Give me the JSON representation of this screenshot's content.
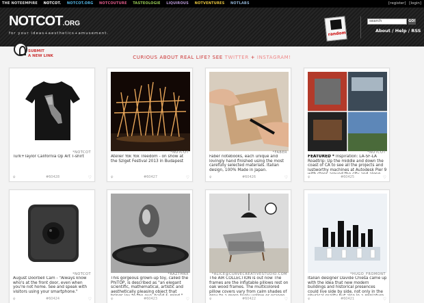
{
  "topnav": {
    "items": [
      {
        "label": "THE NOTEEMPIRE",
        "color": "#dddddd"
      },
      {
        "label": "NOTCOT.",
        "color": "#ffffff"
      },
      {
        "label": "NOTCOT.ORG",
        "color": "#55b7e6"
      },
      {
        "label": "NOTCOUTURE",
        "color": "#e05b8a"
      },
      {
        "label": "TASTEOLOGIE",
        "color": "#9acd57"
      },
      {
        "label": "LIQUIROUS",
        "color": "#b99ad6"
      },
      {
        "label": "NOTVENTURES",
        "color": "#e8c53e"
      },
      {
        "label": "NOTLABS",
        "color": "#8fb0d0"
      }
    ],
    "register": "[register]",
    "login": "[login]"
  },
  "header": {
    "logo": "NOTCOT",
    "logo_suffix": ".ORG",
    "tagline": "for your ideas+aesthetics+amusement.",
    "random_label": "random",
    "search_value": "search",
    "go_label": "GO!",
    "subnav": "About / Help / RSS"
  },
  "submit": {
    "line1": "SUBMIT",
    "line2": "A NEW LINK"
  },
  "banner": {
    "question": "CURIOUS ABOUT REAL LIFE? SEE",
    "twitter": "TWITTER",
    "plus": "+",
    "instagram": "INSTAGRAM!"
  },
  "cards": [
    {
      "source": "*NOTCOT",
      "desc": "Turk+Taylor California Op Art T-shirt",
      "featured": "",
      "number": "#60428",
      "icon": "tshirt-image"
    },
    {
      "source": "*NOTCOT",
      "desc": "Atelier Yok Yok Treedom - on show at the Sziget Festival 2013 in Budapest",
      "featured": "",
      "number": "#60427",
      "icon": "installation-image"
    },
    {
      "source": "*FABER",
      "desc": "Faber notebooks, each unique and lovingly hand finished using the most carefully selected materials. Italian design, 100% Made in Japan.",
      "featured": "",
      "number": "#60426",
      "icon": "notebook-image"
    },
    {
      "source": "*NOTCOT",
      "desc": "Inspiration: LA-SF-LA Roadtrip: Up the middle and down the coast of CA to see all the projects and lustworthy machines at Autodesk Pier 9 with stops around the city and along",
      "featured": "FEATURED *",
      "number": "#60425",
      "icon": "roadtrip-image"
    },
    {
      "source": "*NOTCOT",
      "desc": "August Doorbell Cam - \"Always know who's at the front door, even when you're not home. See and speak with visitors using your smartphone.\"",
      "featured": "",
      "number": "#60424",
      "icon": "doorbell-image"
    },
    {
      "source": "*RAZTHNX",
      "desc": "This gorgeous grown-up toy, called the PhiTOP, is described as \"an elegant scientific, mathematical, artistic and aesthetically pleasing object that brings joy to the eye, hand & mind.\"",
      "featured": "",
      "number": "#60423",
      "icon": "phitop-image"
    },
    {
      "source": "*ALICE@CURVECREATIVESTUDIO.COM",
      "desc": "The AIR COLLECTION is out now The frames are the inflatable pillows rest on oak wood frames. The multicolored pillow covers vary from calm shades of grey to a more lively yellow or orange.",
      "featured": "",
      "number": "#60422",
      "icon": "chair-image"
    },
    {
      "source": "*HUGO_FROMONT",
      "desc": "Italian designer Davide Chiesa came up with the idea that new modern buildings and historical presences could live side by side, not only in the physical reality but also in a miniature",
      "featured": "",
      "number": "#60421",
      "icon": "chess-image"
    }
  ]
}
